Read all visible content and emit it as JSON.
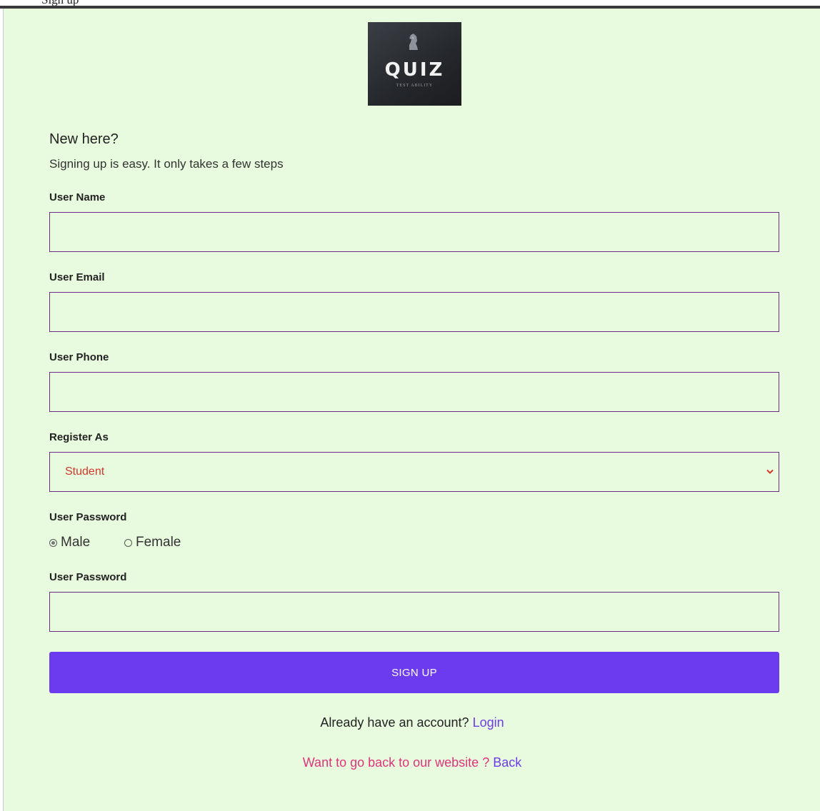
{
  "page": {
    "clipped_top_text": "Sign up"
  },
  "logo": {
    "title": "QUIZ",
    "subtitle": "TEST ABILITY",
    "icon": "knight-icon"
  },
  "intro": {
    "heading": "New here?",
    "subtext": "Signing up is easy. It only takes a few steps"
  },
  "form": {
    "user_name": {
      "label": "User Name",
      "value": "",
      "placeholder": ""
    },
    "user_email": {
      "label": "User Email",
      "value": "",
      "placeholder": ""
    },
    "user_phone": {
      "label": "User Phone",
      "value": "",
      "placeholder": ""
    },
    "register_as": {
      "label": "Register As",
      "selected": "Student",
      "icon": "chevron-down-icon"
    },
    "gender": {
      "label": "User Password",
      "options": [
        {
          "label": "Male",
          "checked": true
        },
        {
          "label": "Female",
          "checked": false
        }
      ]
    },
    "user_password": {
      "label": "User Password",
      "value": "",
      "placeholder": ""
    },
    "submit_label": "SIGN UP"
  },
  "footer": {
    "account_prompt": "Already have an account?",
    "login_link": "Login",
    "back_prompt": "Want to go back to our website ?",
    "back_link": "Back"
  },
  "colors": {
    "background": "#e8fbdf",
    "accent": "#6c3aef",
    "field_border": "#6b2c86",
    "select_text": "#d2372b",
    "back_prompt": "#e2337a"
  }
}
